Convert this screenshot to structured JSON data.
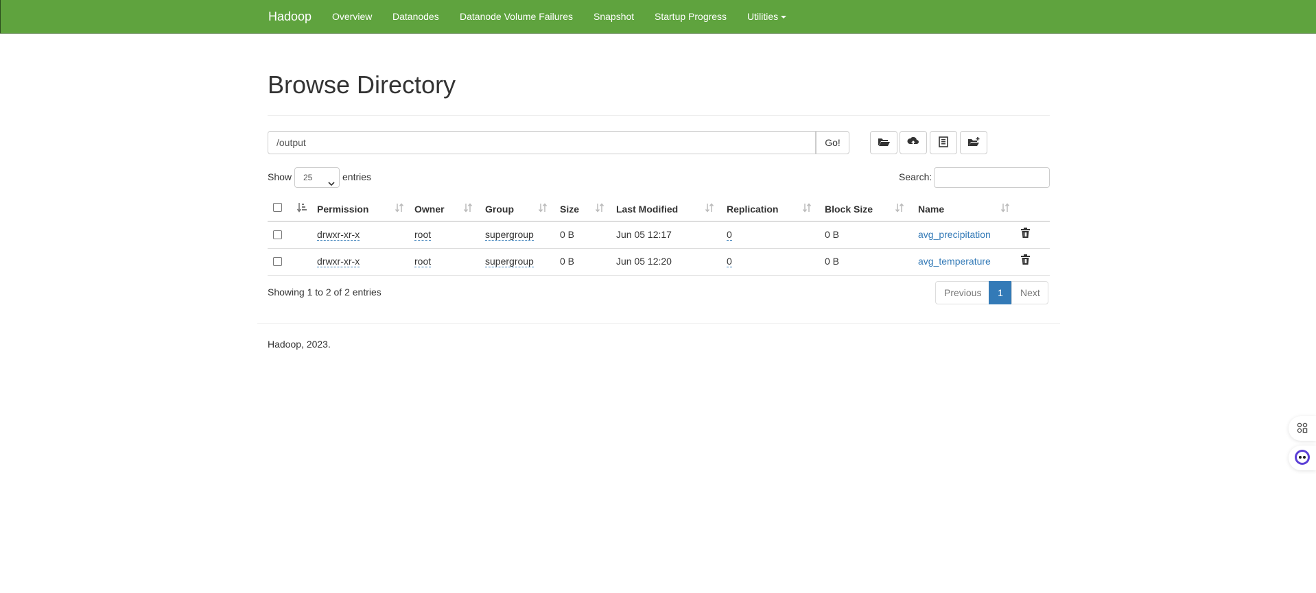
{
  "navbar": {
    "brand": "Hadoop",
    "items": [
      "Overview",
      "Datanodes",
      "Datanode Volume Failures",
      "Snapshot",
      "Startup Progress",
      "Utilities"
    ],
    "bg_color": "#5fa33e"
  },
  "page": {
    "title": "Browse Directory"
  },
  "path_bar": {
    "value": "/output",
    "go_label": "Go!"
  },
  "toolbar": {
    "icons": [
      "folder-open-icon",
      "cloud-upload-icon",
      "list-icon",
      "create-folder-icon"
    ]
  },
  "table_controls": {
    "show_label": "Show",
    "length_value": "25",
    "entries_label": "entries",
    "search_label": "Search:"
  },
  "table": {
    "columns": [
      "Permission",
      "Owner",
      "Group",
      "Size",
      "Last Modified",
      "Replication",
      "Block Size",
      "Name"
    ],
    "rows": [
      {
        "permission": "drwxr-xr-x",
        "owner": "root",
        "group": "supergroup",
        "size": "0 B",
        "modified": "Jun 05 12:17",
        "replication": "0",
        "block_size": "0 B",
        "name": "avg_precipitation"
      },
      {
        "permission": "drwxr-xr-x",
        "owner": "root",
        "group": "supergroup",
        "size": "0 B",
        "modified": "Jun 05 12:20",
        "replication": "0",
        "block_size": "0 B",
        "name": "avg_temperature"
      }
    ]
  },
  "info": "Showing 1 to 2 of 2 entries",
  "pagination": {
    "previous": "Previous",
    "current": "1",
    "next": "Next"
  },
  "footer": "Hadoop, 2023.",
  "colors": {
    "link": "#337ab7",
    "active_page": "#337ab7"
  }
}
